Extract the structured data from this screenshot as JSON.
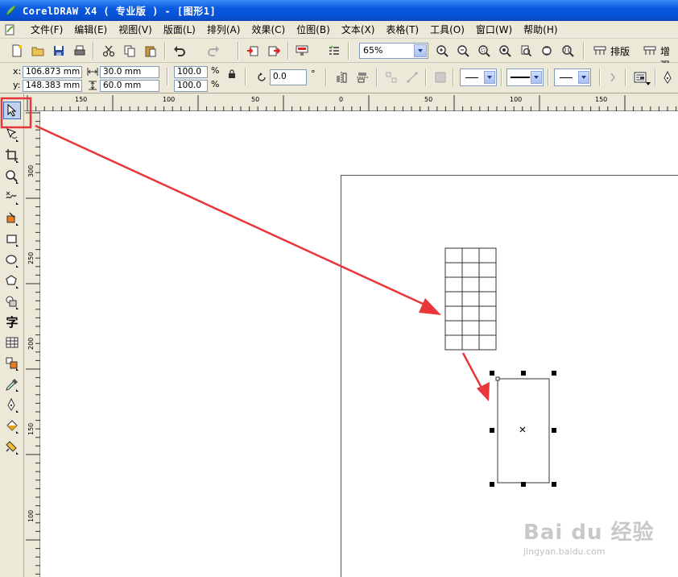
{
  "window": {
    "title": "CorelDRAW X4 ( 专业版 ) - [图形1]"
  },
  "menu": [
    "文件(F)",
    "编辑(E)",
    "视图(V)",
    "版面(L)",
    "排列(A)",
    "效果(C)",
    "位图(B)",
    "文本(X)",
    "表格(T)",
    "工具(O)",
    "窗口(W)",
    "帮助(H)"
  ],
  "toolbar": {
    "zoom_value": "65%",
    "layout_label": "排版",
    "enhance_label": "增强"
  },
  "property_bar": {
    "x_label": "x:",
    "y_label": "y:",
    "x_value": "106.873 mm",
    "y_value": "148.383 mm",
    "width_value": "30.0 mm",
    "height_value": "60.0 mm",
    "scale_x": "100.0",
    "scale_y": "100.0",
    "percent_sign": "%",
    "rotation_value": "0.0",
    "degree_sign": "°"
  },
  "ruler": {
    "h_labels": [
      "150",
      "100",
      "50",
      "0",
      "50",
      "100",
      "150"
    ],
    "v_labels": [
      "300",
      "250",
      "200",
      "150",
      "100"
    ]
  },
  "toolbox": [
    "pick",
    "shape",
    "crop",
    "zoom",
    "freehand",
    "smart-fill",
    "rectangle",
    "ellipse",
    "polygon",
    "basic-shapes",
    "text",
    "table",
    "interactive-blend",
    "eyedropper",
    "outline",
    "fill",
    "interactive-fill"
  ],
  "table_object": {
    "rows": 7,
    "cols": 3
  },
  "annotation_color": "#e8363a",
  "watermark": {
    "brand": "Bai du 经验",
    "url": "jingyan.baidu.com"
  }
}
